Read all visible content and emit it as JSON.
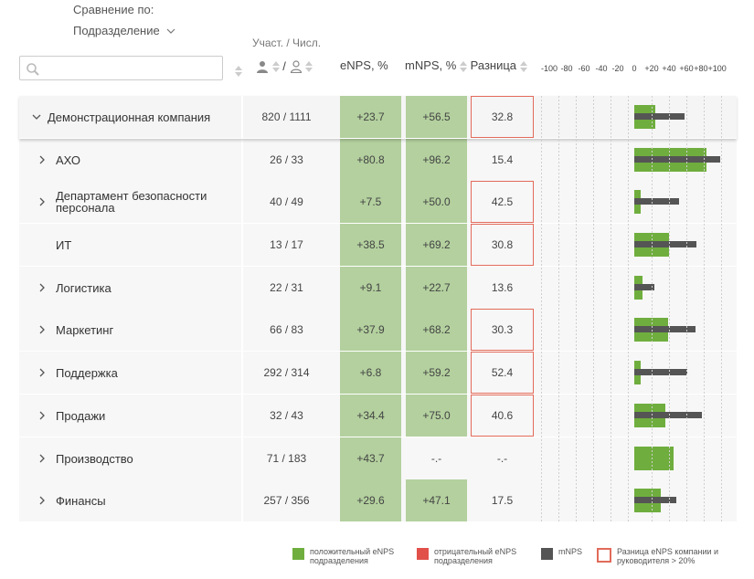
{
  "header": {
    "compare_label": "Сравнение по:",
    "group_by_value": "Подразделение",
    "participants_label": "Участ. / Числ.",
    "search_placeholder": "",
    "count_slash": "/",
    "col_enps": "eNPS, %",
    "col_mnps": "mNPS, %",
    "col_diff": "Разница",
    "scale_ticks": [
      "-100",
      "-80",
      "-60",
      "-40",
      "-20",
      "0",
      "+20",
      "+40",
      "+60",
      "+80+100"
    ]
  },
  "colors": {
    "positive_enps": "#6fae3e",
    "negative_enps": "#e2504a",
    "mnps": "#555555",
    "highlight": "#e26a5a",
    "cell_green": "#b3d09e"
  },
  "rows": [
    {
      "name": "Демонстрационная компания",
      "count": "820 / 1111",
      "enps": "+23.7",
      "mnps": "+56.5",
      "diff": "32.8",
      "highlight": true,
      "expander": "expanded",
      "enps_value": 23.7,
      "mnps_value": 56.5
    },
    {
      "name": "АХО",
      "count": "26 / 33",
      "enps": "+80.8",
      "mnps": "+96.2",
      "diff": "15.4",
      "highlight": false,
      "expander": "collapsed",
      "enps_value": 80.8,
      "mnps_value": 96.2
    },
    {
      "name": "Департамент безопасности персонала",
      "count": "40 / 49",
      "enps": "+7.5",
      "mnps": "+50.0",
      "diff": "42.5",
      "highlight": true,
      "expander": "collapsed",
      "enps_value": 7.5,
      "mnps_value": 50.0
    },
    {
      "name": "ИТ",
      "count": "13 / 17",
      "enps": "+38.5",
      "mnps": "+69.2",
      "diff": "30.8",
      "highlight": true,
      "expander": "none",
      "enps_value": 38.5,
      "mnps_value": 69.2
    },
    {
      "name": "Логистика",
      "count": "22 / 31",
      "enps": "+9.1",
      "mnps": "+22.7",
      "diff": "13.6",
      "highlight": false,
      "expander": "collapsed",
      "enps_value": 9.1,
      "mnps_value": 22.7
    },
    {
      "name": "Маркетинг",
      "count": "66 / 83",
      "enps": "+37.9",
      "mnps": "+68.2",
      "diff": "30.3",
      "highlight": true,
      "expander": "collapsed",
      "enps_value": 37.9,
      "mnps_value": 68.2
    },
    {
      "name": "Поддержка",
      "count": "292 / 314",
      "enps": "+6.8",
      "mnps": "+59.2",
      "diff": "52.4",
      "highlight": true,
      "expander": "collapsed",
      "enps_value": 6.8,
      "mnps_value": 59.2
    },
    {
      "name": "Продажи",
      "count": "32 / 43",
      "enps": "+34.4",
      "mnps": "+75.0",
      "diff": "40.6",
      "highlight": true,
      "expander": "collapsed",
      "enps_value": 34.4,
      "mnps_value": 75.0
    },
    {
      "name": "Производство",
      "count": "71 / 183",
      "enps": "+43.7",
      "mnps": "-.-",
      "diff": "-.-",
      "highlight": false,
      "expander": "collapsed",
      "enps_value": 43.7,
      "mnps_value": null
    },
    {
      "name": "Финансы",
      "count": "257 / 356",
      "enps": "+29.6",
      "mnps": "+47.1",
      "diff": "17.5",
      "highlight": false,
      "expander": "collapsed",
      "enps_value": 29.6,
      "mnps_value": 47.1
    }
  ],
  "legend": [
    {
      "key": "positive",
      "text": "положительный eNPS подразделения"
    },
    {
      "key": "negative",
      "text": "отрицательный eNPS подразделения"
    },
    {
      "key": "mnps",
      "text": "mNPS"
    },
    {
      "key": "highlight",
      "text": "Разница eNPS компании и руководителя > 20%"
    }
  ]
}
